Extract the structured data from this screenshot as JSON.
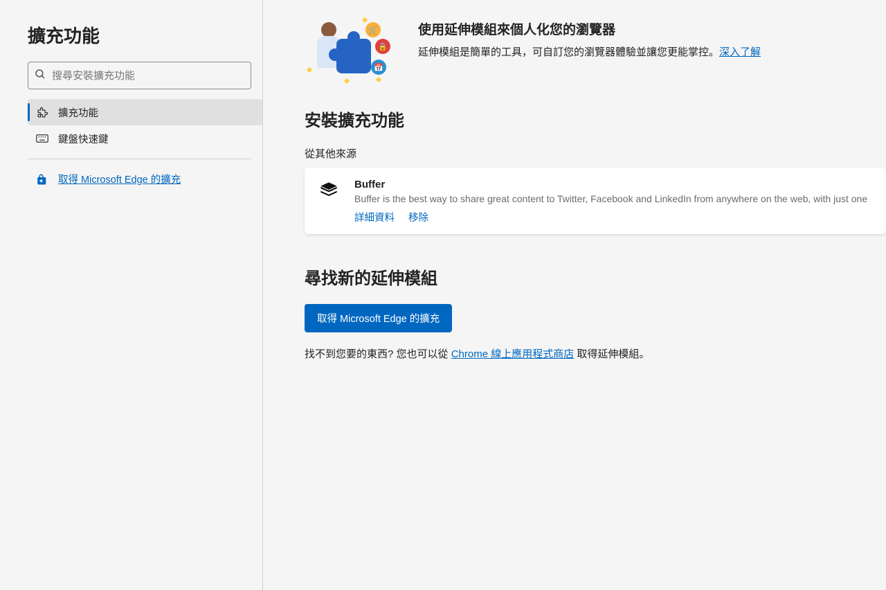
{
  "sidebar": {
    "title": "擴充功能",
    "search_placeholder": "搜尋安裝擴充功能",
    "nav": [
      {
        "label": "擴充功能",
        "active": true,
        "icon": "puzzle-icon"
      },
      {
        "label": "鍵盤快速鍵",
        "active": false,
        "icon": "keyboard-icon"
      }
    ],
    "store_link_label": "取得 Microsoft Edge 的擴充"
  },
  "hero": {
    "title": "使用延伸模組來個人化您的瀏覽器",
    "body": "延伸模組是簡單的工具，可自訂您的瀏覽器體驗並讓您更能掌控。",
    "learn_more_label": "深入了解"
  },
  "installed": {
    "section_title": "安裝擴充功能",
    "source_label": "從其他來源",
    "items": [
      {
        "name": "Buffer",
        "description": "Buffer is the best way to share great content to Twitter, Facebook and LinkedIn from anywhere on the web, with just one",
        "details_label": "詳細資料",
        "remove_label": "移除"
      }
    ]
  },
  "find": {
    "section_title": "尋找新的延伸模組",
    "button_label": "取得 Microsoft Edge 的擴充",
    "help_prefix": "找不到您要的東西? 您也可以從 ",
    "help_link_label": "Chrome 線上應用程式商店",
    "help_suffix": " 取得延伸模組。"
  }
}
